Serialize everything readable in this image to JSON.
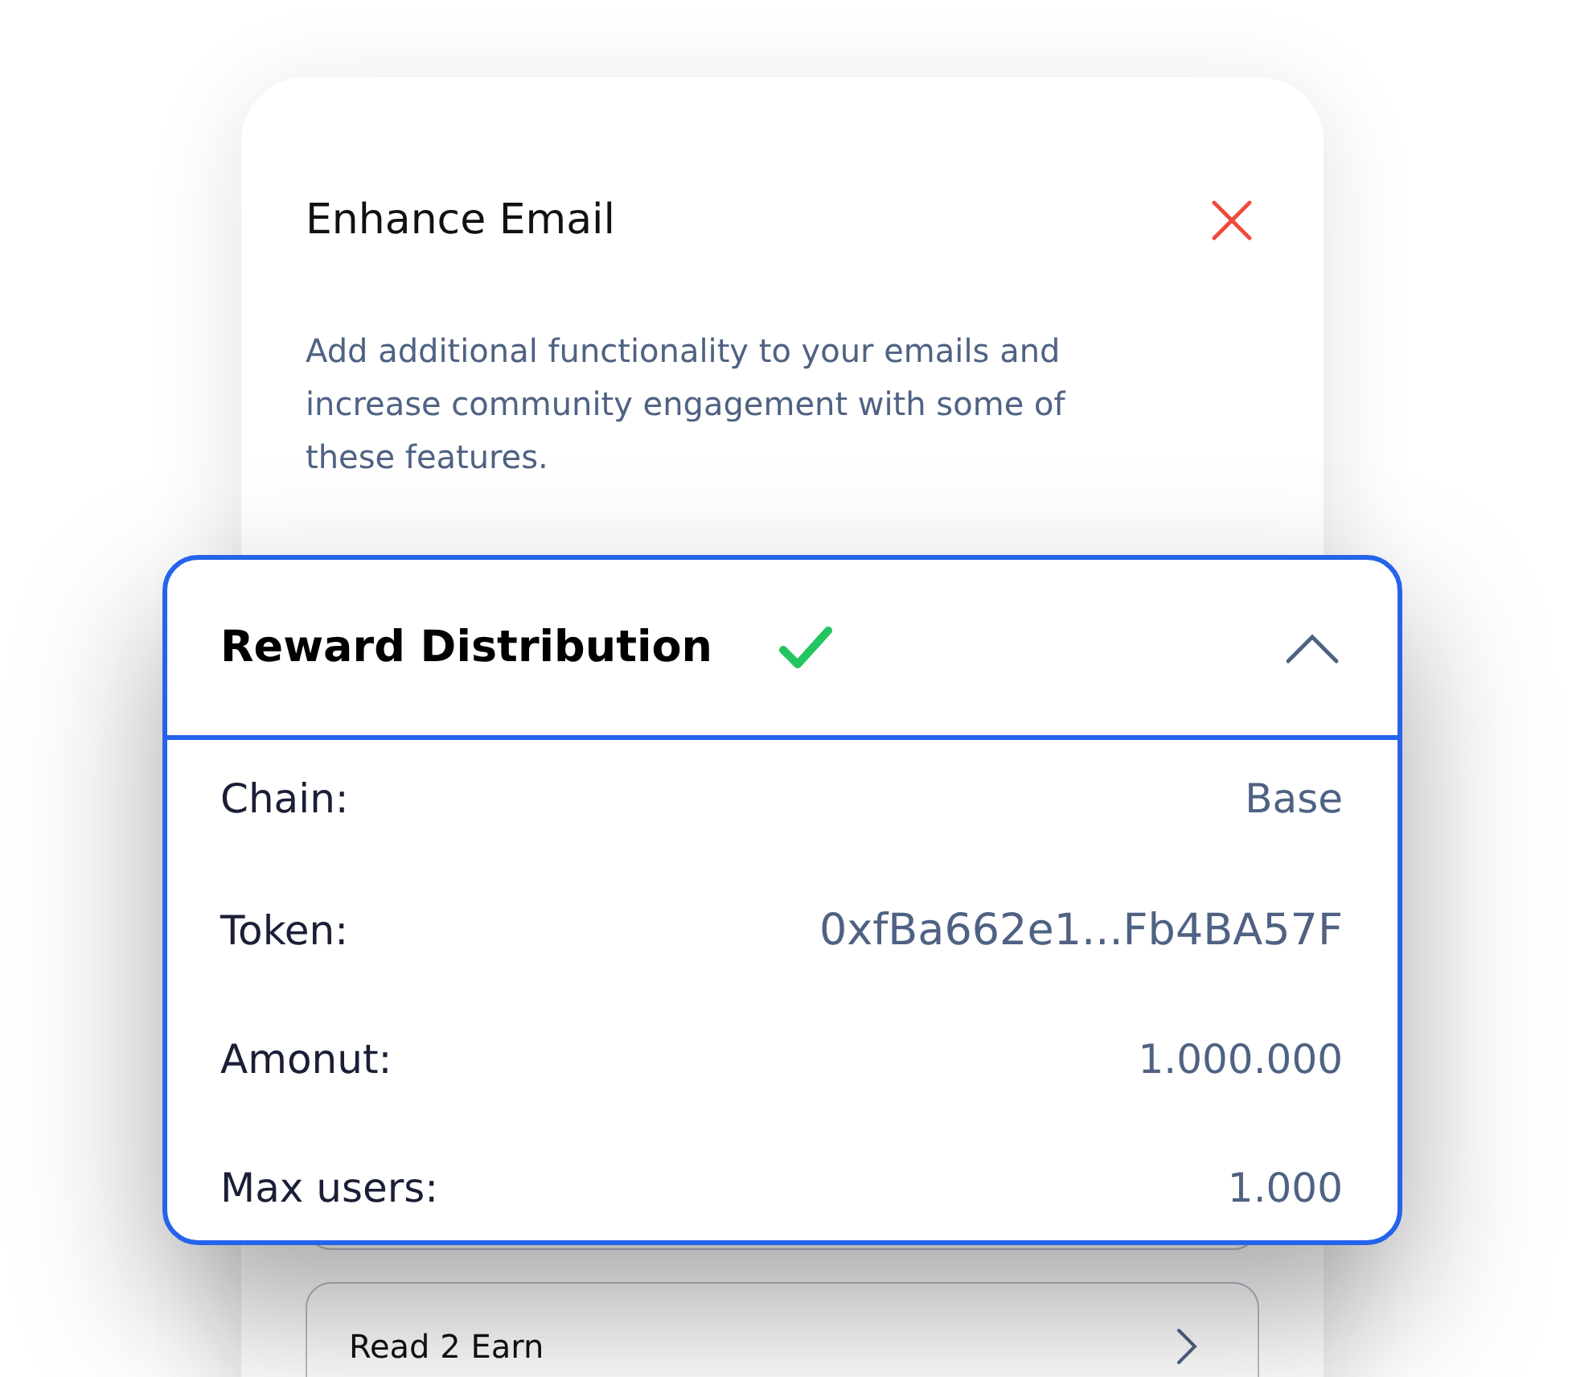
{
  "dialog": {
    "title": "Enhance Email",
    "description": "Add additional functionality to your emails and increase community engagement with some of these features."
  },
  "features": [
    {
      "label": "Read 2 Earn"
    }
  ],
  "reward_panel": {
    "title": "Reward Distribution",
    "complete": true,
    "expanded": true,
    "rows": [
      {
        "label": "Chain:",
        "value": "Base",
        "kind": "text"
      },
      {
        "label": "Token:",
        "value": "0xfBa662e1...Fb4BA57F",
        "kind": "address"
      },
      {
        "label": "Amonut:",
        "value": "1.000.000",
        "kind": "text"
      },
      {
        "label": "Max users:",
        "value": "1.000",
        "kind": "text"
      }
    ]
  }
}
